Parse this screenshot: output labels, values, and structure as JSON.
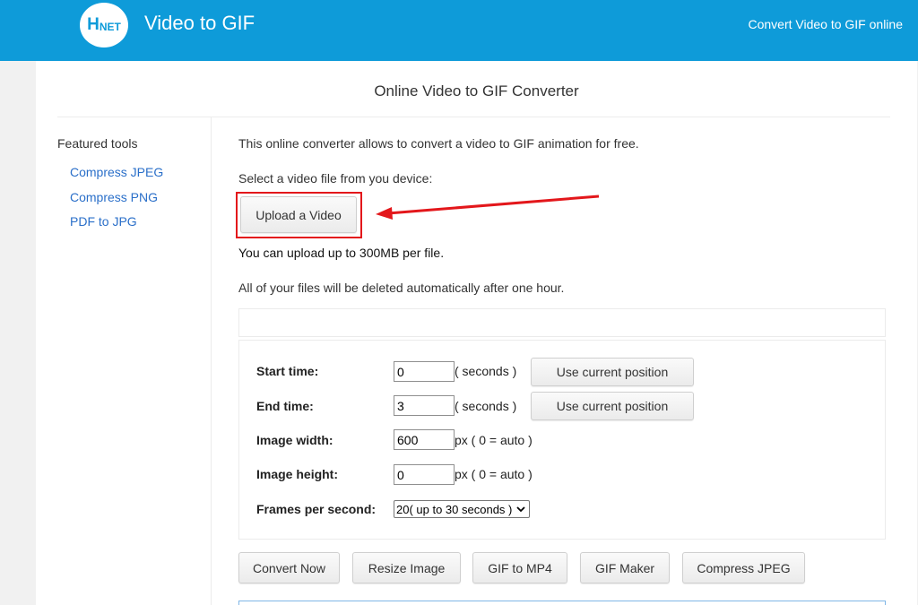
{
  "header": {
    "logo": {
      "big": "H",
      "small": "NET"
    },
    "brand": "Video to GIF",
    "tagline": "Convert Video to GIF online",
    "color": "#0e9bd9"
  },
  "page_title": "Online Video to GIF Converter",
  "sidebar": {
    "heading": "Featured tools",
    "links": [
      "Compress JPEG",
      "Compress PNG",
      "PDF to JPG"
    ]
  },
  "main": {
    "intro": "This online converter allows to convert a video to GIF animation for free.",
    "select_prompt": "Select a video file from you device:",
    "upload_button": "Upload a Video",
    "upload_limit": "You can upload up to 300MB per file.",
    "deletion_note": "All of your files will be deleted automatically after one hour."
  },
  "options": {
    "start_time": {
      "label": "Start time:",
      "value": "0",
      "unit": "( seconds )",
      "button": "Use current position"
    },
    "end_time": {
      "label": "End time:",
      "value": "3",
      "unit": "( seconds )",
      "button": "Use current position"
    },
    "image_width": {
      "label": "Image width:",
      "value": "600",
      "unit": "px ( 0 = auto )"
    },
    "image_height": {
      "label": "Image height:",
      "value": "0",
      "unit": "px ( 0 = auto )"
    },
    "fps": {
      "label": "Frames per second:",
      "selected": "20( up to 30 seconds )"
    }
  },
  "actions": [
    "Convert Now",
    "Resize Image",
    "GIF to MP4",
    "GIF Maker",
    "Compress JPEG"
  ],
  "annotation": {
    "highlight_color": "#e3171b"
  }
}
